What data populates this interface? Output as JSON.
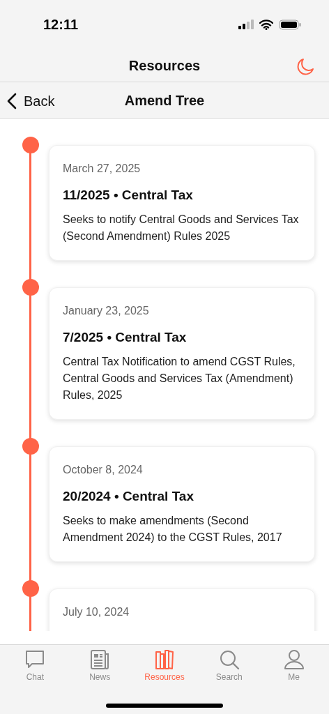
{
  "status_bar": {
    "time": "12:11"
  },
  "header": {
    "title": "Resources"
  },
  "nav_bar": {
    "back": "Back",
    "title": "Amend Tree"
  },
  "timeline": [
    {
      "date": "March 27, 2025",
      "title": "11/2025 • Central Tax",
      "description": "Seeks to notify Central Goods and Services Tax (Second Amendment) Rules 2025"
    },
    {
      "date": "January 23, 2025",
      "title": "7/2025 • Central Tax",
      "description": "Central Tax Notification to amend CGST Rules, Central Goods and Services Tax (Amendment) Rules, 2025"
    },
    {
      "date": "October 8, 2024",
      "title": "20/2024 • Central Tax",
      "description": "Seeks to make amendments (Second Amendment 2024) to the CGST Rules, 2017"
    },
    {
      "date": "July 10, 2024"
    }
  ],
  "tab_bar": [
    {
      "label": "Chat",
      "kind": "chat",
      "selected": false
    },
    {
      "label": "News",
      "kind": "news",
      "selected": false
    },
    {
      "label": "Resources",
      "kind": "books",
      "selected": true
    },
    {
      "label": "Search",
      "kind": "search",
      "selected": false
    },
    {
      "label": "Me",
      "kind": "person",
      "selected": false
    }
  ]
}
